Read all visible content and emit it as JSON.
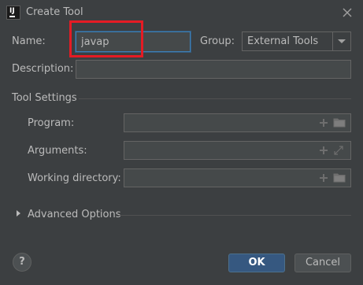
{
  "window": {
    "title": "Create Tool",
    "app_icon_letters": "IJ"
  },
  "form": {
    "name_label": "Name:",
    "name_value": "javap",
    "group_label": "Group:",
    "group_value": "External Tools",
    "description_label": "Description:",
    "description_value": ""
  },
  "tool_settings": {
    "title": "Tool Settings",
    "program_label": "Program:",
    "program_value": "",
    "arguments_label": "Arguments:",
    "arguments_value": "",
    "working_directory_label": "Working directory:",
    "working_directory_value": ""
  },
  "advanced": {
    "label": "Advanced Options"
  },
  "buttons": {
    "help_label": "?",
    "ok_label": "OK",
    "cancel_label": "Cancel"
  },
  "icons": {
    "close": "close-icon",
    "plus": "plus-icon",
    "folder": "folder-icon",
    "expand": "expand-icon",
    "combo_arrow": "chevron-down-icon",
    "advanced_arrow": "chevron-right-icon"
  },
  "colors": {
    "background": "#3c3f41",
    "field_background": "#45494a",
    "focus_border": "#3d7fb5",
    "highlight": "#e51b24",
    "ok_button": "#365880"
  }
}
